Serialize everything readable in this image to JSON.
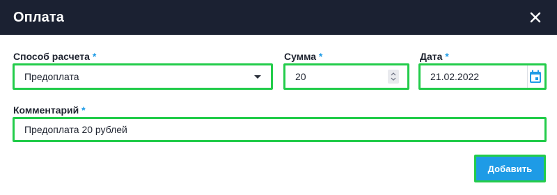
{
  "dialog": {
    "title": "Оплата",
    "close_icon": "close-icon"
  },
  "form": {
    "payment_method": {
      "label": "Способ расчета",
      "required_mark": "*",
      "value": "Предоплата",
      "icon": "chevron-down-icon"
    },
    "amount": {
      "label": "Сумма",
      "required_mark": "*",
      "value": "20",
      "icon": "spinner-icon"
    },
    "date": {
      "label": "Дата",
      "required_mark": "*",
      "value": "21.02.2022",
      "icon": "calendar-icon"
    },
    "comment": {
      "label": "Комментарий",
      "required_mark": "*",
      "value": "Предоплата 20 рублей"
    }
  },
  "actions": {
    "submit_label": "Добавить"
  },
  "colors": {
    "header_bg": "#1b2132",
    "accent": "#1e9be6",
    "highlight_border": "#22cc4a"
  }
}
